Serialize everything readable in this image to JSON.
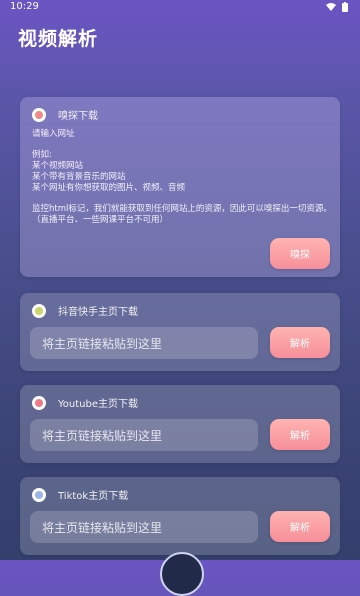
{
  "status": {
    "time": "10:29"
  },
  "app": {
    "title": "视频解析"
  },
  "sniff": {
    "title": "嗅探下载",
    "prompt": "请输入网址",
    "example_title": "例如:",
    "examples": [
      "某个视频网站",
      "某个带有背景音乐的网站",
      "某个网址有你想获取的图片、视频、音频"
    ],
    "description": "监控html标记，我们就能获取到任何网站上的资源，因此可以嗅探出一切资源。（直播平台、一些网课平台不可用）",
    "button": "嗅探",
    "icon_color": "#f08a8a"
  },
  "douyin": {
    "title": "抖音快手主页下载",
    "placeholder": "将主页链接粘贴到这里",
    "button": "解析",
    "icon_color": "#c9d66a"
  },
  "youtube": {
    "title": "Youtube主页下载",
    "placeholder": "将主页链接粘贴到这里",
    "button": "解析",
    "icon_color": "#f07a8a"
  },
  "tiktok": {
    "title": "Tiktok主页下载",
    "placeholder": "将主页链接粘贴到这里",
    "button": "解析",
    "icon_color": "#9ab4e8"
  }
}
